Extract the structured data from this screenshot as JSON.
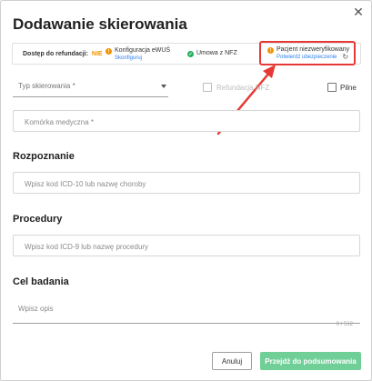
{
  "dialog": {
    "title": "Dodawanie skierowania",
    "close_icon": "close-icon"
  },
  "status_bar": {
    "access_label": "Dostęp do refundacji:",
    "access_value": "NIE",
    "ewus": {
      "label": "Konfiguracja eWUŚ",
      "link": "Skonfiguruj",
      "icon": "warning-icon"
    },
    "nfz": {
      "label": "Umowa z NFZ",
      "icon": "check-icon"
    },
    "patient": {
      "label": "Pacjent niezweryfikowany",
      "link": "Potwierdź ubezpieczenie",
      "icon": "warning-icon",
      "action_icon": "refresh-icon"
    }
  },
  "form": {
    "type_select": {
      "placeholder": "Typ skierowania *"
    },
    "refund_checkbox": {
      "label": "Refundacja NFZ",
      "checked": false,
      "disabled": true
    },
    "urgent_checkbox": {
      "label": "Pilne",
      "checked": false
    },
    "cell_input": {
      "placeholder": "Komórka medyczna *"
    },
    "diagnosis": {
      "title": "Rozpoznanie",
      "placeholder": "Wpisz kod ICD-10 lub nazwę choroby"
    },
    "procedures": {
      "title": "Procedury",
      "placeholder": "Wpisz kod ICD-9 lub nazwę procedury"
    },
    "purpose": {
      "title": "Cel badania",
      "placeholder": "Wpisz opis",
      "counter": "0 / 512"
    }
  },
  "footer": {
    "cancel_label": "Anuluj",
    "submit_label": "Przejdź do podsumowania"
  },
  "colors": {
    "accent_warning": "#f39200",
    "accent_success": "#27ae60",
    "submit_bg": "#6fcf97",
    "link": "#2f80ed",
    "annotation": "#e53935"
  }
}
